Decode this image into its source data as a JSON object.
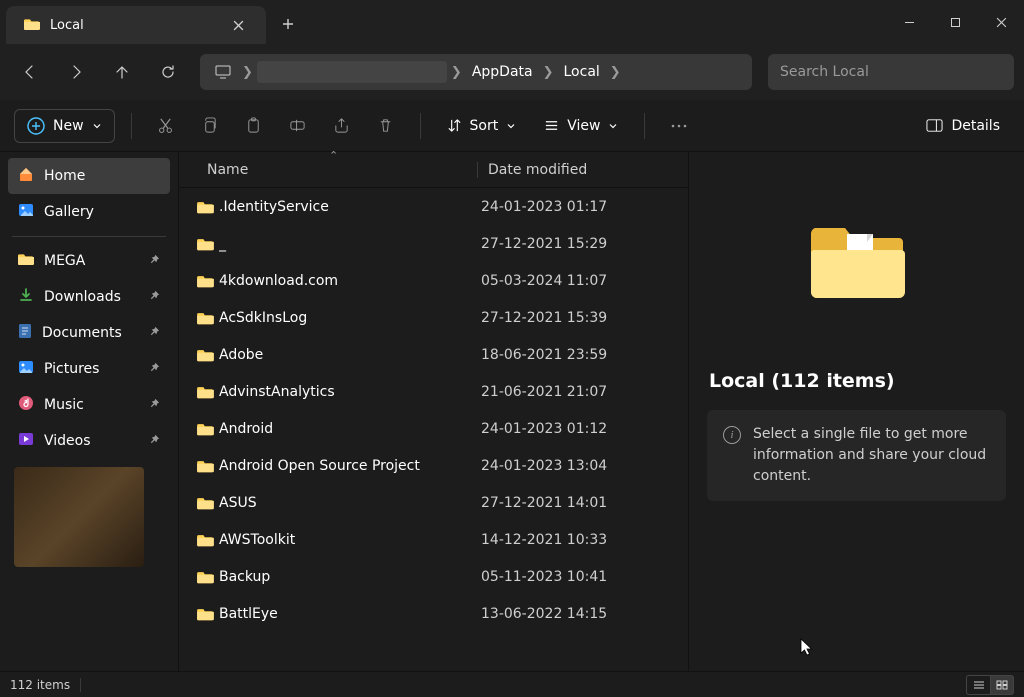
{
  "tab": {
    "title": "Local"
  },
  "breadcrumb": {
    "segments": [
      "AppData",
      "Local"
    ]
  },
  "search": {
    "placeholder": "Search Local"
  },
  "toolbar": {
    "new_label": "New",
    "sort_label": "Sort",
    "view_label": "View",
    "details_label": "Details"
  },
  "sidebar": {
    "home": "Home",
    "gallery": "Gallery",
    "items": [
      {
        "label": "MEGA",
        "icon": "folder",
        "pinned": true
      },
      {
        "label": "Downloads",
        "icon": "download",
        "pinned": true
      },
      {
        "label": "Documents",
        "icon": "document",
        "pinned": true
      },
      {
        "label": "Pictures",
        "icon": "pictures",
        "pinned": true
      },
      {
        "label": "Music",
        "icon": "music",
        "pinned": true
      },
      {
        "label": "Videos",
        "icon": "videos",
        "pinned": true
      }
    ]
  },
  "columns": {
    "name": "Name",
    "date": "Date modified"
  },
  "rows": [
    {
      "name": ".IdentityService",
      "date": "24-01-2023 01:17"
    },
    {
      "name": "_",
      "date": "27-12-2021 15:29"
    },
    {
      "name": "4kdownload.com",
      "date": "05-03-2024 11:07"
    },
    {
      "name": "AcSdkInsLog",
      "date": "27-12-2021 15:39"
    },
    {
      "name": "Adobe",
      "date": "18-06-2021 23:59"
    },
    {
      "name": "AdvinstAnalytics",
      "date": "21-06-2021 21:07"
    },
    {
      "name": "Android",
      "date": "24-01-2023 01:12"
    },
    {
      "name": "Android Open Source Project",
      "date": "24-01-2023 13:04"
    },
    {
      "name": "ASUS",
      "date": "27-12-2021 14:01"
    },
    {
      "name": "AWSToolkit",
      "date": "14-12-2021 10:33"
    },
    {
      "name": "Backup",
      "date": "05-11-2023 10:41"
    },
    {
      "name": "BattlEye",
      "date": "13-06-2022 14:15"
    }
  ],
  "details": {
    "title": "Local (112 items)",
    "hint": "Select a single file to get more information and share your cloud content."
  },
  "status": {
    "text": "112 items"
  }
}
